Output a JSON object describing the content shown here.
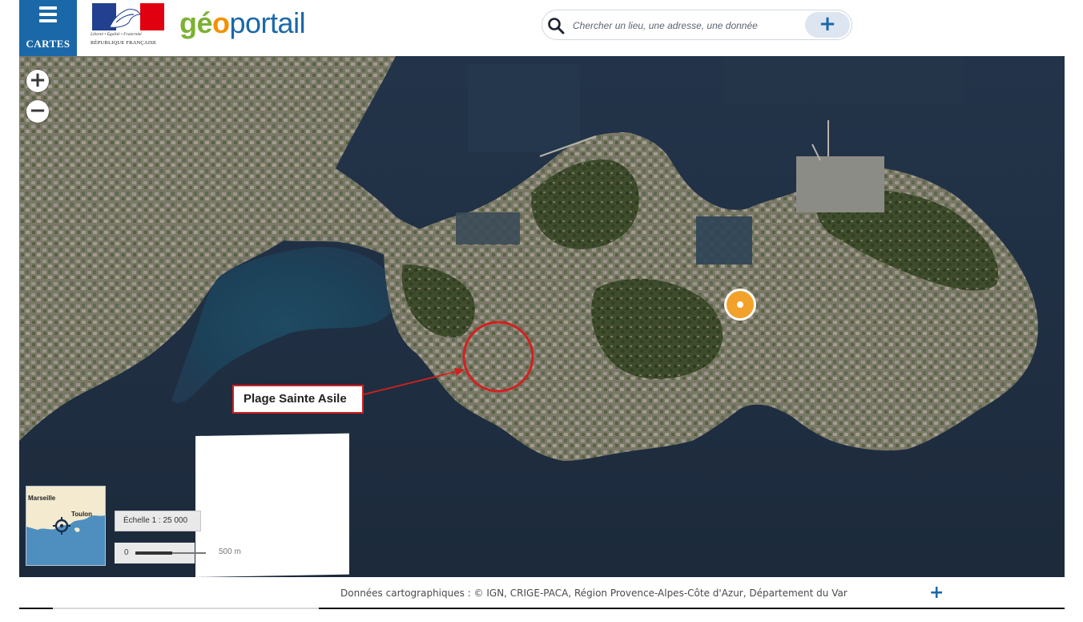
{
  "header": {
    "menu_label": "CARTES",
    "republic_motto": "Liberté • Égalité • Fraternité",
    "republic_name": "RÉPUBLIQUE FRANÇAISE",
    "brand_ge": "gé",
    "brand_o": "o",
    "brand_portail": "portail"
  },
  "search": {
    "placeholder": "Chercher un lieu, une adresse, une donnée",
    "plus_label": "+"
  },
  "map": {
    "zoom_in_label": "+",
    "zoom_out_label": "−",
    "annotation_label": "Plage Sainte Asile",
    "overview": {
      "place_1": "Marseille",
      "place_2": "Toulon"
    },
    "scale_text": "Échelle 1 : 25 000",
    "scale_bar": {
      "zero": "0",
      "distance": "500 m"
    }
  },
  "footer": {
    "attribution": "Données cartographiques : ©  IGN,  CRIGE-PACA,  Région Provence-Alpes-Côte d'Azur,  Département du Var",
    "attribution_plus": "+"
  },
  "colors": {
    "brand_blue": "#1a68a8",
    "brand_green": "#7cb134",
    "brand_orange": "#f29100",
    "annotation_red": "#d32020",
    "marker_orange": "#f2a12a"
  },
  "icons": {
    "menu": "menu-icon",
    "search": "search-icon",
    "locate_marker": "location-marker-icon",
    "overview_target": "crosshair-icon"
  }
}
